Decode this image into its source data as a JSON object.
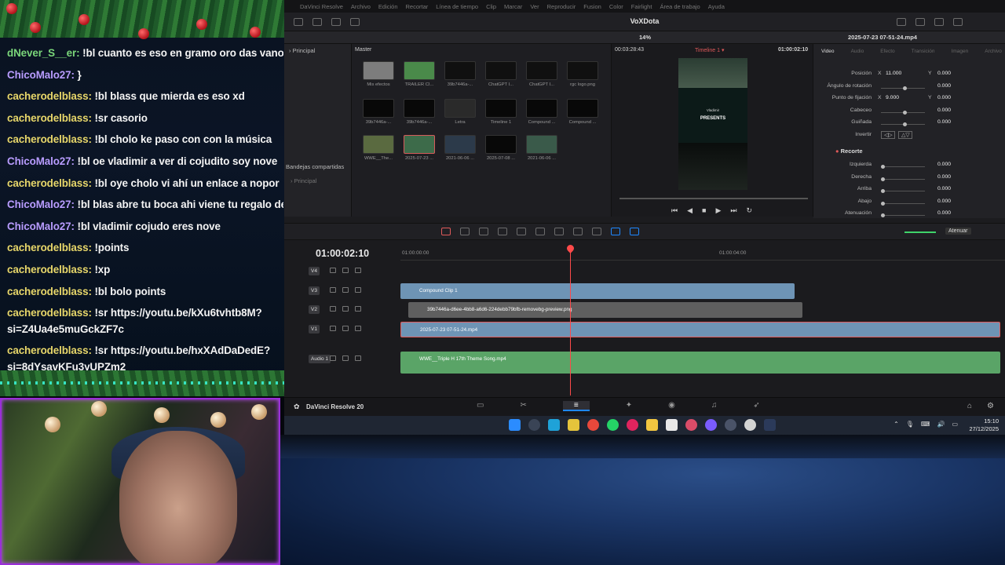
{
  "chat": {
    "messages": [
      {
        "user": "dNever_S__er:",
        "text": "!bl cuanto es eso en gramo oro das vano",
        "color": "never"
      },
      {
        "user": "ChicoMalo27:",
        "text": "}",
        "color": "chico"
      },
      {
        "user": "cacherodelblass:",
        "text": "!bl blass que mierda es eso xd",
        "color": "cache"
      },
      {
        "user": "cacherodelblass:",
        "text": "!sr casorio",
        "color": "cache"
      },
      {
        "user": "cacherodelblass:",
        "text": "!bl cholo ke paso con con la música",
        "color": "cache"
      },
      {
        "user": "ChicoMalo27:",
        "text": "!bl oe vladimir a ver di cojudito soy nove",
        "color": "chico"
      },
      {
        "user": "cacherodelblass:",
        "text": "!bl oye cholo vi ahí un enlace a nopor",
        "color": "cache"
      },
      {
        "user": "ChicoMalo27:",
        "text": "!bl blas abre tu boca ahi viene tu regalo de nav",
        "color": "chico"
      },
      {
        "user": "ChicoMalo27:",
        "text": "!bl vladimir cojudo eres nove",
        "color": "chico"
      },
      {
        "user": "cacherodelblass:",
        "text": "!points",
        "color": "cache"
      },
      {
        "user": "cacherodelblass:",
        "text": "!xp",
        "color": "cache"
      },
      {
        "user": "cacherodelblass:",
        "text": "!bl bolo points",
        "color": "cache"
      },
      {
        "user": "cacherodelblass:",
        "text": "!sr https://youtu.be/kXu6tvhtb8M?si=Z4Ua4e5muGckZF7c",
        "color": "cache",
        "wrap": true
      },
      {
        "user": "cacherodelblass:",
        "text": "!sr https://youtu.be/hxXAdDaDedE?si=8dYsavKFu3yUPZm2",
        "color": "cache",
        "wrap": true
      }
    ]
  },
  "resolve": {
    "menu": [
      "DaVinci Resolve",
      "Archivo",
      "Edición",
      "Recortar",
      "Línea de tiempo",
      "Clip",
      "Marcar",
      "Ver",
      "Reproducir",
      "Fusion",
      "Color",
      "Fairlight",
      "Área de trabajo",
      "Ayuda"
    ],
    "project_title": "VoXDota",
    "zoom": "14%",
    "pool_sidebar": {
      "root": "Principal",
      "shared_header": "Bandejas compartidas",
      "shared_item": "Principal"
    },
    "bin_name": "Master",
    "clips_row1": [
      "Mis efectos",
      "TRÁILER CI...",
      "39b7446a-...",
      "ChatGPT I...",
      "ChatGPT I...",
      "rgc logo.png"
    ],
    "clips_row2": [
      "39b7446a-...",
      "39b7446a-...",
      "Letra",
      "Timeline 1",
      "Compound ...",
      "Compound ..."
    ],
    "clips_row3": [
      "WWE__The...",
      "2025-07-23 ...",
      "2021-06-06 ...",
      "2025-07-08 ...",
      "2021-06-06 ..."
    ],
    "viewer": {
      "source_tc": "00:03:28:43",
      "timeline_name": "Timeline 1",
      "record_tc": "01:00:02:10",
      "frame_title": "PRESENTS",
      "frame_sub": "Vladimir"
    },
    "inspector": {
      "filename": "2025-07-23 07-51-24.mp4",
      "tabs": [
        "Video",
        "Audio",
        "Efecto",
        "Transición",
        "Imagen",
        "Archivo"
      ],
      "active_tab": "Video",
      "rows": [
        {
          "label": "Posición",
          "x_label": "X",
          "x": "11.000",
          "y_label": "Y",
          "y": "0.000"
        },
        {
          "label": "Ángulo de rotación",
          "value": "0.000",
          "knob": 0.5
        },
        {
          "label": "Punto de fijación",
          "x_label": "X",
          "x": "9.000",
          "y_label": "Y",
          "y": "0.000"
        },
        {
          "label": "Cabeceo",
          "value": "0.000",
          "knob": 0.5
        },
        {
          "label": "Guiñada",
          "value": "0.000",
          "knob": 0.5
        },
        {
          "label": "Invertir"
        }
      ],
      "crop_section": "Recorte",
      "crop_rows": [
        {
          "label": "Izquierda",
          "value": "0.000"
        },
        {
          "label": "Derecha",
          "value": "0.000"
        },
        {
          "label": "Arriba",
          "value": "0.000"
        },
        {
          "label": "Abajo",
          "value": "0.000"
        },
        {
          "label": "Atenuación",
          "value": "0.000"
        }
      ]
    },
    "timeline": {
      "timecode": "01:00:02:10",
      "ruler": [
        "01:00:00:00",
        "01:00:04:00"
      ],
      "tracks": [
        {
          "name": "V4"
        },
        {
          "name": "V3",
          "clip": "Compound Clip 1"
        },
        {
          "name": "V2",
          "clip": "39b7446a-d6ee-4bb8-a6d6-224debb79bfb-removebg-preview.png"
        },
        {
          "name": "V1",
          "clip": "2025-07-23 07-51-24.mp4"
        },
        {
          "name": "Audio 1",
          "clip": "WWE__Triple H 17th Theme Song.mp4"
        }
      ],
      "audio_label": "Atenuar"
    },
    "app_name": "DaVinci Resolve 20"
  },
  "taskbar": {
    "time": "15:10",
    "date": "27/12/2025"
  },
  "colors": {
    "accent": "#1e88ff",
    "playhead": "#ff4a4a",
    "video_clip": "#6e94b5",
    "audio_clip": "#5aa467",
    "cam_border": "#9a2fd8"
  }
}
